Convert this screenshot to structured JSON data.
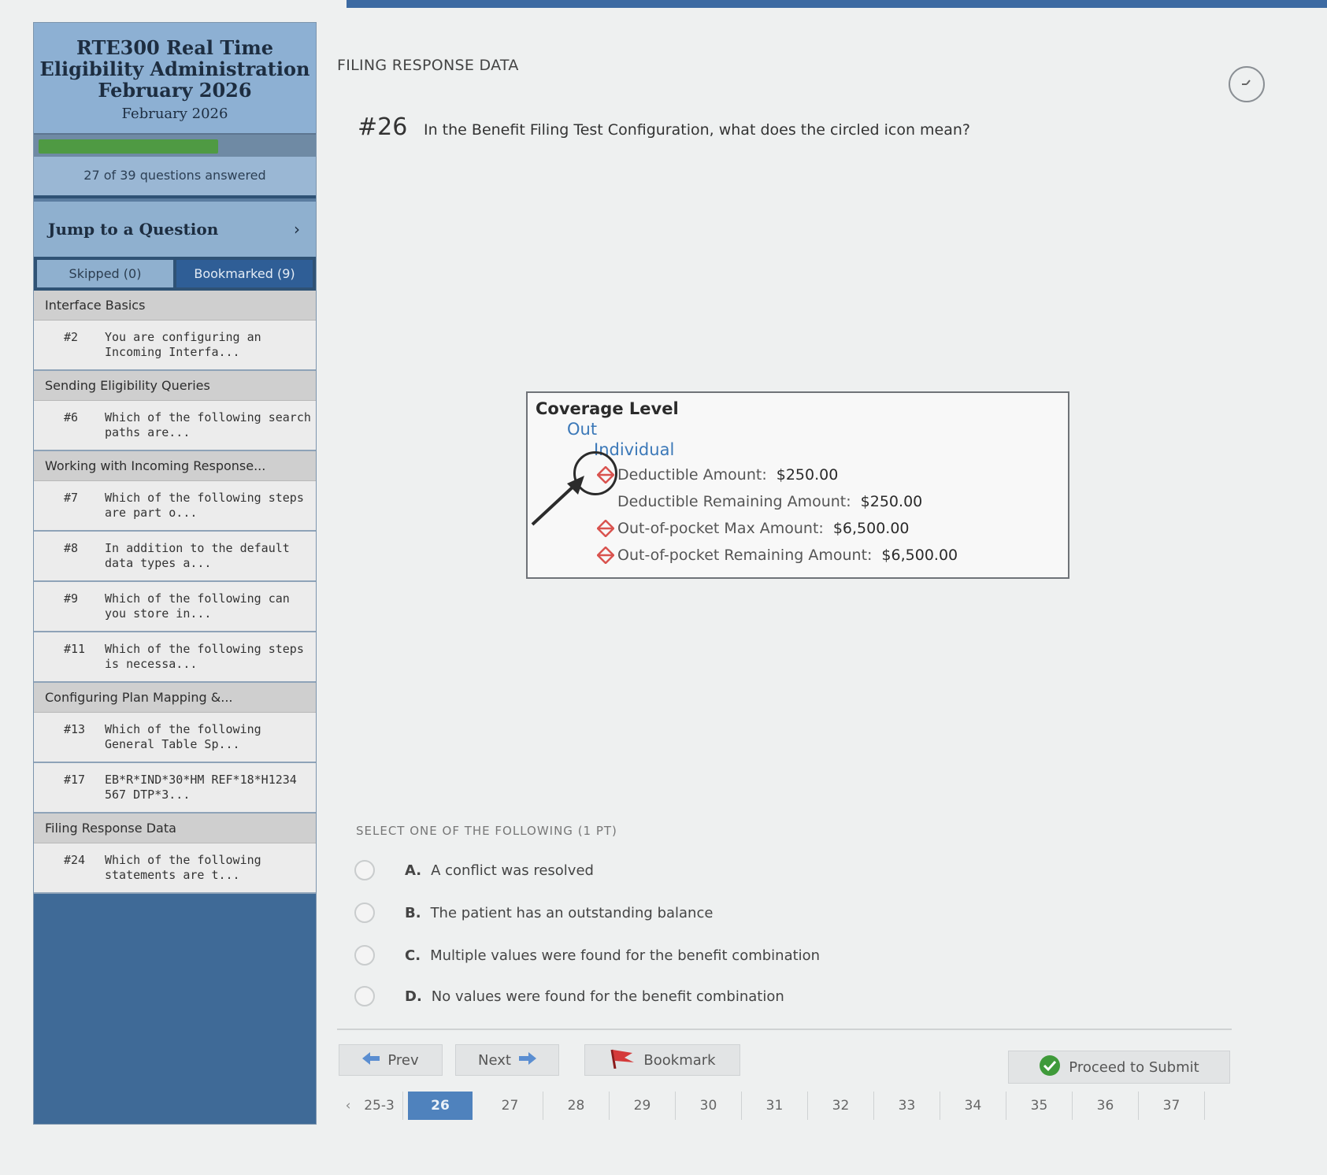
{
  "sidebar": {
    "title": "RTE300 Real Time Eligibility Administration February 2026",
    "subtitle": "February 2026",
    "progress": 0.69,
    "count_text": "27 of 39 questions answered",
    "jump_label": "Jump to a Question",
    "jump_arrow": "›",
    "tabs": {
      "skipped": "Skipped (0)",
      "bookmarked": "Bookmarked (9)"
    },
    "groups": [
      {
        "section": "Interface Basics",
        "items": [
          {
            "num": "#2",
            "text": "You are configuring an Incoming Interfa..."
          }
        ]
      },
      {
        "section": "Sending Eligibility Queries",
        "items": [
          {
            "num": "#6",
            "text": "Which of the following search paths are..."
          }
        ]
      },
      {
        "section": "Working with Incoming Response...",
        "items": [
          {
            "num": "#7",
            "text": "Which of the following steps are part o..."
          },
          {
            "num": "#8",
            "text": "In addition to the default data types a..."
          },
          {
            "num": "#9",
            "text": "Which of the following can you store in..."
          },
          {
            "num": "#11",
            "text": "Which of the following steps is necessa..."
          }
        ]
      },
      {
        "section": "Configuring Plan Mapping &...",
        "items": [
          {
            "num": "#13",
            "text": "Which of the following General Table Sp..."
          },
          {
            "num": "#17",
            "text": "EB*R*IND*30*HM REF*18*H1234 567 DTP*3..."
          }
        ]
      },
      {
        "section": "Filing Response Data",
        "items": [
          {
            "num": "#24",
            "text": "Which of the following statements are t..."
          }
        ]
      }
    ]
  },
  "main": {
    "section_title": "FILING RESPONSE DATA",
    "timer_icon": "clock-icon",
    "question_number": "#26",
    "question_text": "In the Benefit Filing Test Configuration, what does the circled icon mean?",
    "coverage": {
      "title": "Coverage Level",
      "out": "Out",
      "individual": "Individual",
      "rows": [
        {
          "label": "Deductible Amount:",
          "value": "$250.00",
          "warn": true
        },
        {
          "label": "Deductible Remaining Amount:",
          "value": "$250.00",
          "warn": false
        },
        {
          "label": "Out-of-pocket Max Amount:",
          "value": "$6,500.00",
          "warn": true
        },
        {
          "label": "Out-of-pocket Remaining Amount:",
          "value": "$6,500.00",
          "warn": true
        }
      ],
      "warn_color": "#d9534f"
    },
    "select_label": "SELECT ONE OF THE FOLLOWING (1 PT)",
    "answers": [
      {
        "letter": "A.",
        "text": "A conflict was resolved"
      },
      {
        "letter": "B.",
        "text": "The patient has an outstanding balance"
      },
      {
        "letter": "C.",
        "text": "Multiple values were found for the benefit combination"
      },
      {
        "letter": "D.",
        "text": "No values were found for the benefit combination"
      }
    ]
  },
  "nav": {
    "prev": "Prev",
    "next": "Next",
    "bookmark": "Bookmark",
    "submit": "Proceed to Submit",
    "pager": {
      "back_arrow": "‹",
      "range_label": "25-3",
      "pages": [
        "26",
        "27",
        "28",
        "29",
        "30",
        "31",
        "32",
        "33",
        "34",
        "35",
        "36",
        "37"
      ],
      "active": "26"
    }
  },
  "colors": {
    "accent": "#4f82bd",
    "progress": "#4f9a43",
    "sidebar": "#3f6a97"
  }
}
